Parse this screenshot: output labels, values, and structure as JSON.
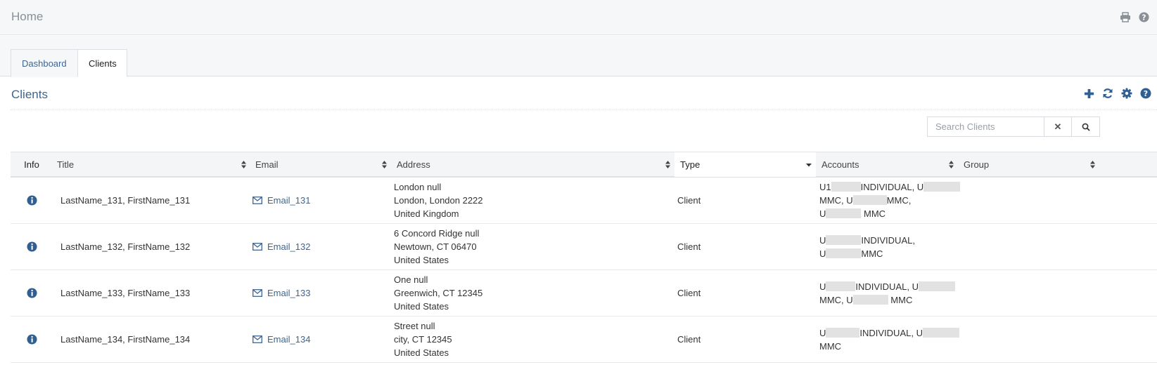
{
  "header": {
    "title": "Home"
  },
  "tabs": [
    {
      "label": "Dashboard",
      "active": false
    },
    {
      "label": "Clients",
      "active": true
    }
  ],
  "section": {
    "title": "Clients"
  },
  "search": {
    "placeholder": "Search Clients",
    "value": ""
  },
  "columns": {
    "info": "Info",
    "title": "Title",
    "email": "Email",
    "address": "Address",
    "type": "Type",
    "accounts": "Accounts",
    "group": "Group"
  },
  "rows": [
    {
      "title": "LastName_131, FirstName_131",
      "email": "Email_131",
      "address": [
        "London null",
        "London, London 2222",
        "United Kingdom"
      ],
      "type": "Client",
      "accounts": [
        "U1",
        "INDIVIDUAL, U",
        "MMC, U",
        "MMC,",
        "U",
        "MMC"
      ],
      "group": ""
    },
    {
      "title": "LastName_132, FirstName_132",
      "email": "Email_132",
      "address": [
        "6 Concord Ridge null",
        "Newtown, CT 06470",
        "United States"
      ],
      "type": "Client",
      "accounts": [
        "U",
        "INDIVIDUAL,",
        "U",
        "MMC"
      ],
      "group": ""
    },
    {
      "title": "LastName_133, FirstName_133",
      "email": "Email_133",
      "address": [
        "One null",
        "Greenwich, CT 12345",
        "United States"
      ],
      "type": "Client",
      "accounts": [
        "U",
        "INDIVIDUAL, U",
        "MMC, U",
        "MMC"
      ],
      "group": ""
    },
    {
      "title": "LastName_134, FirstName_134",
      "email": "Email_134",
      "address": [
        "Street null",
        "city, CT 12345",
        "United States"
      ],
      "type": "Client",
      "accounts": [
        "U",
        "INDIVIDUAL, U",
        "MMC"
      ],
      "group": ""
    }
  ],
  "colors": {
    "link": "#3e6591",
    "icon": "#2f5f93",
    "header_text": "#8a8f98"
  }
}
